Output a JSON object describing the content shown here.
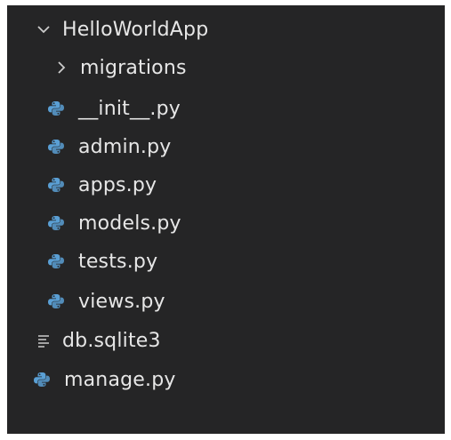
{
  "explorer": {
    "root_folder": {
      "label": "HelloWorldApp",
      "expanded": true,
      "icon": "chevron-down-icon"
    },
    "subfolder": {
      "label": "migrations",
      "expanded": false,
      "icon": "chevron-right-icon"
    },
    "app_files": [
      {
        "label": "__init__.py",
        "icon": "python-icon"
      },
      {
        "label": "admin.py",
        "icon": "python-icon"
      },
      {
        "label": "apps.py",
        "icon": "python-icon"
      },
      {
        "label": "models.py",
        "icon": "python-icon"
      },
      {
        "label": "tests.py",
        "icon": "python-icon"
      },
      {
        "label": "views.py",
        "icon": "python-icon"
      }
    ],
    "root_files": [
      {
        "label": "db.sqlite3",
        "icon": "lines-file-icon"
      },
      {
        "label": "manage.py",
        "icon": "python-icon"
      }
    ]
  },
  "colors": {
    "background": "#252526",
    "text": "#e6e6e6",
    "python_icon": "#5a9fd4",
    "chevron": "#cccccc"
  }
}
